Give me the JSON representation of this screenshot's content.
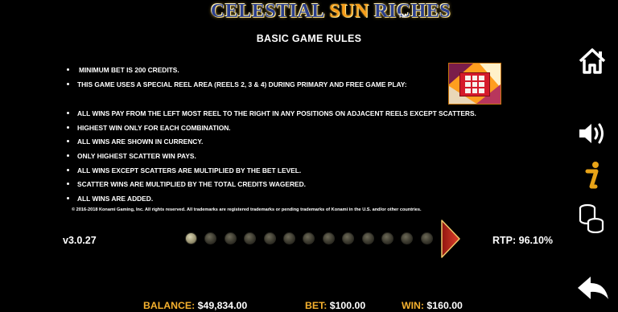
{
  "logo": {
    "text_a": "CELESTIAL ",
    "text_sun": "SUN",
    "text_b": " RICHES",
    "tm": "TM"
  },
  "page_title": "BASIC GAME RULES",
  "rules": [
    "MINIMUM BET IS 200 CREDITS.",
    "THIS GAME USES A SPECIAL REEL AREA (REELS 2, 3 & 4) DURING PRIMARY AND FREE GAME PLAY:",
    "ALL WINS PAY FROM THE LEFT MOST REEL TO THE RIGHT IN ANY POSITIONS ON ADJACENT REELS EXCEPT SCATTERS.",
    "HIGHEST WIN ONLY FOR EACH COMBINATION.",
    "ALL WINS ARE SHOWN IN CURRENCY.",
    "ONLY HIGHEST SCATTER WIN PAYS.",
    "ALL WINS EXCEPT SCATTERS ARE MULTIPLIED BY THE BET LEVEL.",
    "SCATTER WINS ARE MULTIPLIED BY THE TOTAL CREDITS WAGERED.",
    "ALL WINS ARE ADDED."
  ],
  "copyright": "© 2016-2018 Konami Gaming, Inc. All rights reserved. All trademarks are registered trademarks or pending trademarks of Konami in the U.S. and/or other countries.",
  "side_icons": [
    "home-icon",
    "speaker-icon",
    "info-icon",
    "coins-icon",
    "back-icon"
  ],
  "version": "v3.0.27",
  "rtp": "RTP: 96.10%",
  "pagination": {
    "total_pages": 13,
    "current_page": 1
  },
  "status": {
    "balance_label": "BALANCE:",
    "balance_value": "$49,834.00",
    "bet_label": "BET:",
    "bet_value": "$100.00",
    "win_label": "WIN:",
    "win_value": "$160.00"
  },
  "colors": {
    "accent_gold": "#f5b12e",
    "arrow_red": "#c8281c",
    "info_gold": "#e8a317"
  }
}
